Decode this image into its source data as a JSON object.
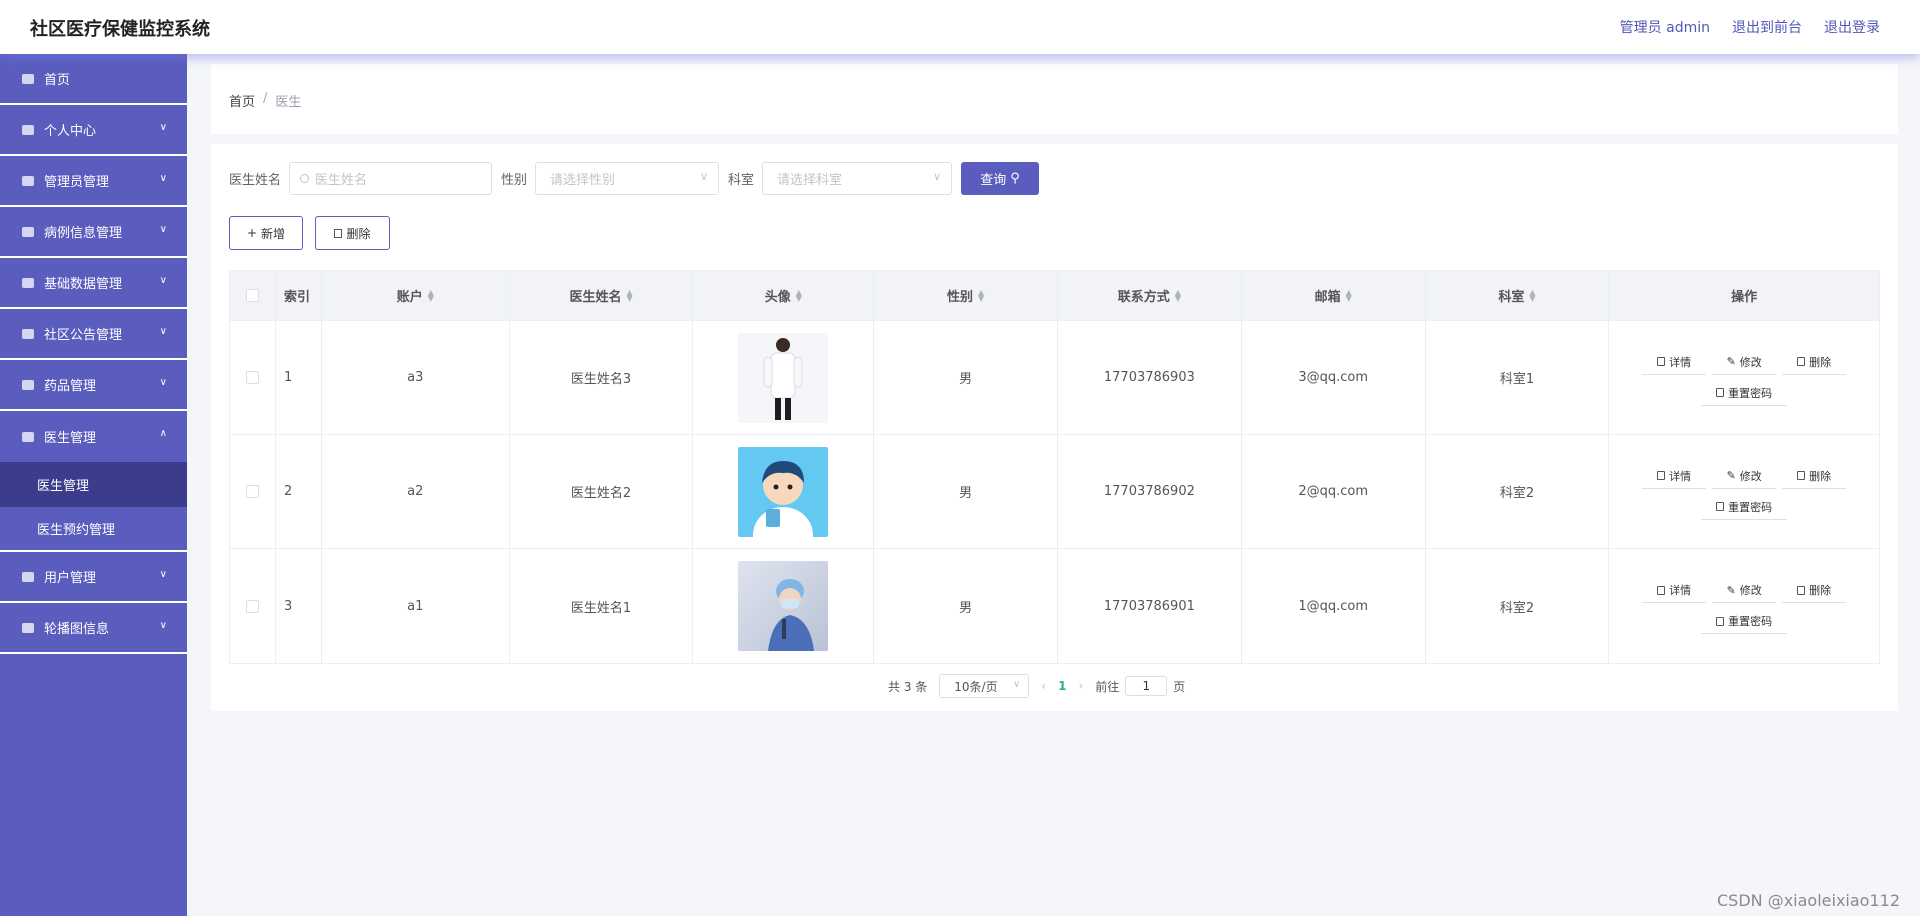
{
  "header": {
    "title": "社区医疗保健监控系统",
    "admin_link": "管理员 admin",
    "front_link": "退出到前台",
    "logout_link": "退出登录"
  },
  "sidebar": {
    "items": [
      {
        "label": "首页",
        "icon": "home-icon"
      },
      {
        "label": "个人中心",
        "icon": "user-icon"
      },
      {
        "label": "管理员管理",
        "icon": "admin-icon"
      },
      {
        "label": "病例信息管理",
        "icon": "sliders-icon"
      },
      {
        "label": "基础数据管理",
        "icon": "message-icon"
      },
      {
        "label": "社区公告管理",
        "icon": "bulb-icon"
      },
      {
        "label": "药品管理",
        "icon": "ticket-icon"
      },
      {
        "label": "医生管理",
        "icon": "fullscreen-icon"
      }
    ],
    "sub_items": [
      "医生管理",
      "医生预约管理"
    ],
    "bottom_items": [
      {
        "label": "用户管理",
        "icon": "monitor-icon"
      },
      {
        "label": "轮播图信息",
        "icon": "monitor-icon"
      }
    ]
  },
  "breadcrumb": {
    "home": "首页",
    "separator": "/",
    "current": "医生"
  },
  "search": {
    "name_label": "医生姓名",
    "name_placeholder": "医生姓名",
    "sex_label": "性别",
    "sex_placeholder": "请选择性别",
    "dept_label": "科室",
    "dept_placeholder": "请选择科室",
    "query_button": "查询"
  },
  "actions": {
    "add": "新增",
    "delete": "删除"
  },
  "table": {
    "headers": {
      "index": "索引",
      "account": "账户",
      "name": "医生姓名",
      "avatar": "头像",
      "sex": "性别",
      "phone": "联系方式",
      "email": "邮箱",
      "dept": "科室",
      "ops": "操作"
    },
    "rows": [
      {
        "index": "1",
        "account": "a3",
        "name": "医生姓名3",
        "sex": "男",
        "phone": "17703786903",
        "email": "3@qq.com",
        "dept": "科室1"
      },
      {
        "index": "2",
        "account": "a2",
        "name": "医生姓名2",
        "sex": "男",
        "phone": "17703786902",
        "email": "2@qq.com",
        "dept": "科室2"
      },
      {
        "index": "3",
        "account": "a1",
        "name": "医生姓名1",
        "sex": "男",
        "phone": "17703786901",
        "email": "1@qq.com",
        "dept": "科室2"
      }
    ],
    "op_labels": {
      "detail": "详情",
      "edit": "修改",
      "delete": "删除",
      "reset": "重置密码"
    }
  },
  "pagination": {
    "total": "共 3 条",
    "page_size": "10条/页",
    "current_page": "1",
    "goto_prefix": "前往",
    "goto_value": "1",
    "goto_suffix": "页"
  },
  "watermark": "CSDN @xiaoleixiao112",
  "colors": {
    "accent": "#5a5dbe",
    "active_sub": "#3b3d8c",
    "page_number": "#2cb67d"
  }
}
